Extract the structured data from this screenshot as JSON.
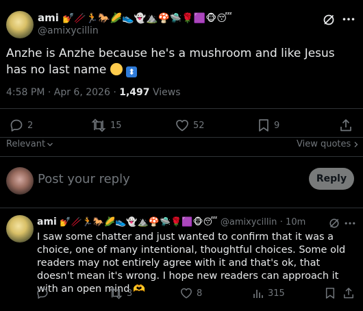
{
  "main_post": {
    "display_name": "ami",
    "display_emojis": "💅🥢🏃🐎🌽👟👻⛰️🍄🛸🌹🟪🐵😴",
    "handle": "@amixycillin",
    "text": "Anzhe is Anzhe because he's a mushroom and like Jesus has no last name",
    "text_emojis": "🙂⬍",
    "timestamp": "4:58 PM · Apr 6, 2026 ·",
    "views_count": "1,497",
    "views_label": "Views",
    "stats": {
      "replies": "2",
      "reposts": "15",
      "likes": "52",
      "bookmarks": "9"
    }
  },
  "sort": {
    "relevant_label": "Relevant",
    "view_quotes_label": "View quotes"
  },
  "composer": {
    "placeholder": "Post your reply",
    "reply_button": "Reply"
  },
  "reply": {
    "display_name": "ami",
    "display_emojis": "💅🥢🏃🐎🌽👟👻⛰️🍄🛸🌹🟪🐵😴",
    "handle": "@amixycillin",
    "time": "· 10m",
    "text": "I saw some chatter and just wanted to confirm that it was a choice, one of many intentional, thoughtful choices. Some old readers may not entirely agree with it and that's ok, that doesn't mean it's wrong. I hope new readers can approach it with an open mind 🫶",
    "stats": {
      "reposts": "3",
      "likes": "8",
      "views": "315"
    }
  },
  "icons": {
    "grok": "grok-icon",
    "more": "more-icon",
    "reply": "reply-icon",
    "repost": "repost-icon",
    "like": "heart-icon",
    "bookmark": "bookmark-icon",
    "share": "share-icon",
    "views": "views-icon"
  }
}
